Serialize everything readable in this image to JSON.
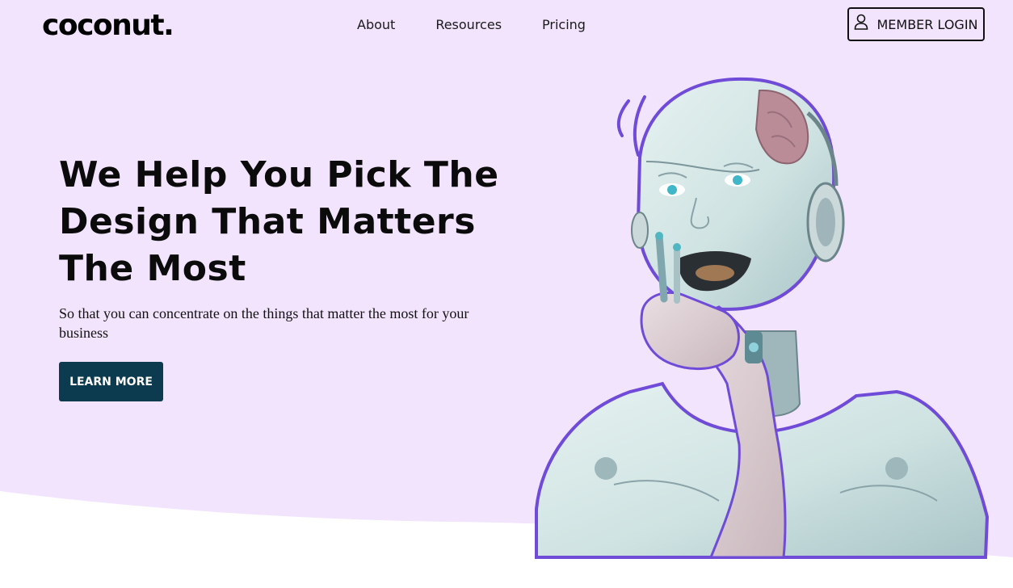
{
  "brand": {
    "logo_text": "coconut."
  },
  "nav": {
    "links": [
      {
        "label": "About"
      },
      {
        "label": "Resources"
      },
      {
        "label": "Pricing"
      }
    ],
    "login": {
      "label": "MEMBER LOGIN",
      "icon": "user-icon"
    }
  },
  "hero": {
    "headline": "We Help You Pick The Design That Matters The Most",
    "subtext": "So that you can concentrate on the things that matter the most for your business",
    "cta_label": "LEARN MORE",
    "illustration": "robot-thinking-illustration"
  },
  "colors": {
    "hero_background": "#f2e4fd",
    "cta_background": "#0c3a4e",
    "robot_outline": "#6f4bd8"
  }
}
